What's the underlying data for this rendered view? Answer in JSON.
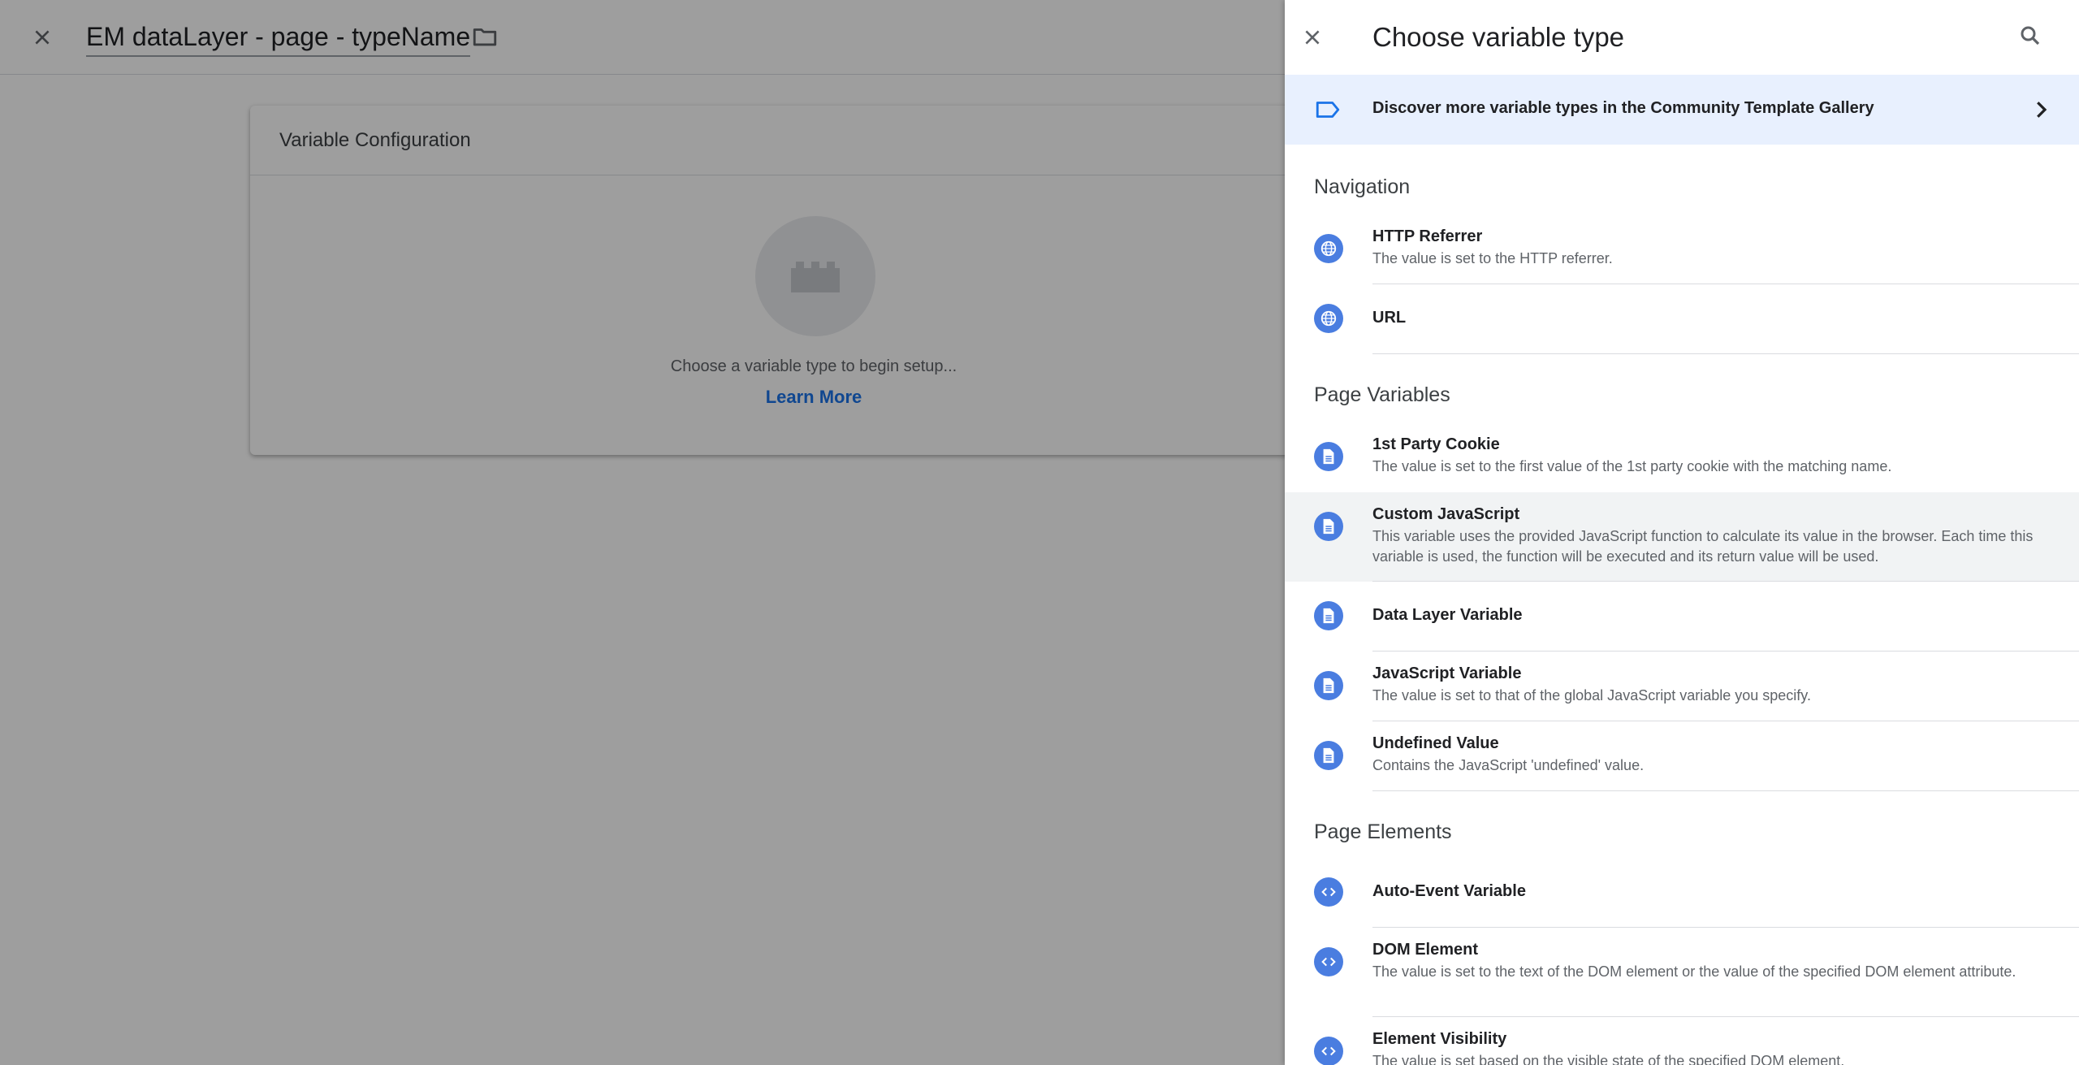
{
  "background": {
    "title": "EM dataLayer - page - typeName",
    "card_title": "Variable Configuration",
    "placeholder_text": "Choose a variable type to begin setup...",
    "learn_more": "Learn More"
  },
  "panel": {
    "title": "Choose variable type",
    "gallery_text": "Discover more variable types in the Community Template Gallery",
    "sections": [
      {
        "title": "Navigation",
        "items": [
          {
            "name": "HTTP Referrer",
            "desc": "The value is set to the HTTP referrer.",
            "icon": "globe-icon"
          },
          {
            "name": "URL",
            "desc": "",
            "icon": "globe-icon"
          }
        ]
      },
      {
        "title": "Page Variables",
        "items": [
          {
            "name": "1st Party Cookie",
            "desc": "The value is set to the first value of the 1st party cookie with the matching name.",
            "icon": "document-icon"
          },
          {
            "name": "Custom JavaScript",
            "desc": "This variable uses the provided JavaScript function to calculate its value in the browser. Each time this variable is used, the function will be executed and its return value will be used.",
            "icon": "document-icon"
          },
          {
            "name": "Data Layer Variable",
            "desc": "",
            "icon": "document-icon"
          },
          {
            "name": "JavaScript Variable",
            "desc": "The value is set to that of the global JavaScript variable you specify.",
            "icon": "document-icon"
          },
          {
            "name": "Undefined Value",
            "desc": "Contains the JavaScript 'undefined' value.",
            "icon": "document-icon"
          }
        ]
      },
      {
        "title": "Page Elements",
        "items": [
          {
            "name": "Auto-Event Variable",
            "desc": "",
            "icon": "code-icon"
          },
          {
            "name": "DOM Element",
            "desc": "The value is set to the text of the DOM element or the value of the specified DOM element attribute.",
            "icon": "code-icon"
          },
          {
            "name": "Element Visibility",
            "desc": "The value is set based on the visible state of the specified DOM element.",
            "icon": "code-icon"
          }
        ]
      }
    ]
  },
  "colors": {
    "accent": "#1a73e8",
    "icon_bg": "#4a7de0",
    "gallery_bg": "#e8f0fe",
    "highlight_row": "#f1f3f4"
  }
}
